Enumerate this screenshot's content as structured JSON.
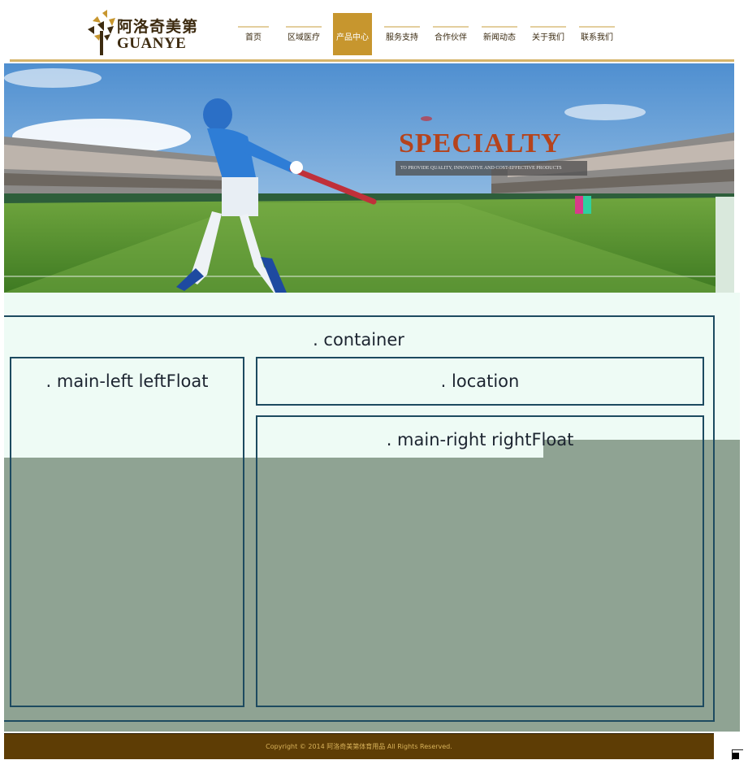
{
  "header": {
    "logo": {
      "cn": "阿洛奇美第",
      "en": "GUANYE"
    },
    "nav": [
      {
        "label": "首页"
      },
      {
        "label": "区域医疗"
      },
      {
        "label": "产品中心",
        "active": true
      },
      {
        "label": "服务支持"
      },
      {
        "label": "合作伙伴"
      },
      {
        "label": "新闻动态"
      },
      {
        "label": "关于我们"
      },
      {
        "label": "联系我们"
      }
    ]
  },
  "banner": {
    "title": "SPECIALTY",
    "subtitle": "TO PROVIDE QUALITY, INNOVATIVE AND COST-EFFECTIVE PRODUCTS"
  },
  "layout": {
    "container_label": ". container",
    "left_label": ". main-left leftFloat",
    "location_label": ". location",
    "right_label": ". main-right rightFloat"
  },
  "footer": {
    "copyright": "Copyright © 2014 阿洛奇美第体育用品 All Rights Reserved."
  },
  "colors": {
    "brand_gold": "#c7962e",
    "footer_brown": "#5e3d05",
    "layout_border": "#1d4a60",
    "layout_bg": "#eefbf5",
    "layout_shade": "#8fa393"
  }
}
